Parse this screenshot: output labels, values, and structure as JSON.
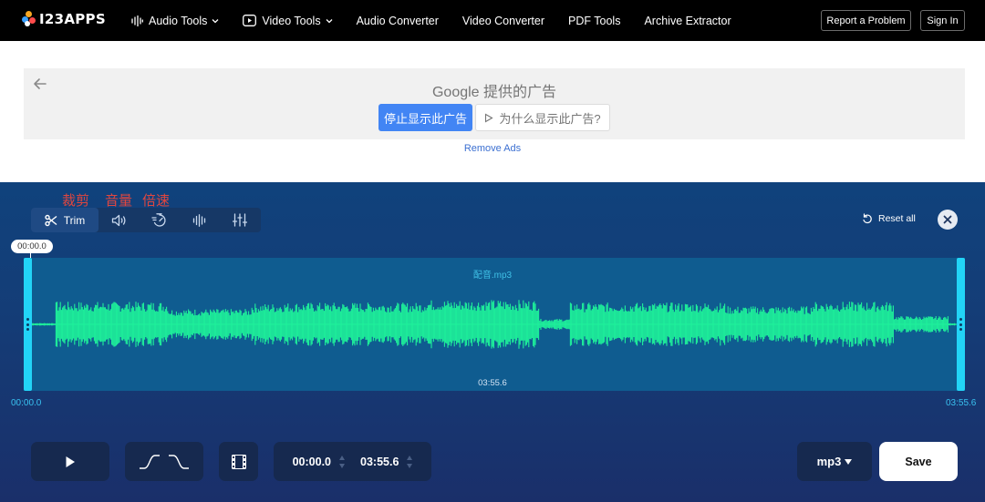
{
  "nav": {
    "logo_text": "I23APPS",
    "items": [
      {
        "label": "Audio Tools",
        "icon": "audio-wave-icon",
        "dropdown": true
      },
      {
        "label": "Video Tools",
        "icon": "play-box-icon",
        "dropdown": true
      },
      {
        "label": "Audio Converter"
      },
      {
        "label": "Video Converter"
      },
      {
        "label": "PDF Tools"
      },
      {
        "label": "Archive Extractor"
      }
    ],
    "report_label": "Report a Problem",
    "signin_label": "Sign In"
  },
  "ad": {
    "title": "Google 提供的广告",
    "stop_label": "停止显示此广告",
    "why_label": "为什么显示此广告?",
    "remove_ads_label": "Remove Ads"
  },
  "annotations": {
    "trim": "裁剪",
    "volume": "音量",
    "speed": "倍速"
  },
  "toolbar": {
    "tabs": [
      {
        "label": "Trim",
        "icon": "scissors-icon",
        "active": true
      },
      {
        "label": "",
        "icon": "volume-icon"
      },
      {
        "label": "",
        "icon": "speed-icon"
      },
      {
        "label": "",
        "icon": "waveform-icon"
      },
      {
        "label": "",
        "icon": "equalizer-icon"
      }
    ],
    "reset_label": "Reset all"
  },
  "waveform": {
    "start_badge": "00:00.0",
    "file_name": "配音.mp3",
    "duration_label": "03:55.6",
    "time_left": "00:00.0",
    "time_right": "03:55.6",
    "wave_color": "#1ef29a"
  },
  "controls": {
    "start_time": "00:00.0",
    "end_time": "03:55.6",
    "format": "mp3",
    "save_label": "Save"
  },
  "colors": {
    "accent": "#4285f4",
    "handle": "#22d4f7",
    "wave": "#1ef29a"
  }
}
